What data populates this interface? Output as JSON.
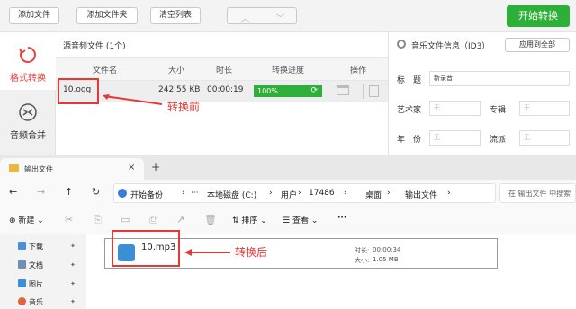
{
  "toolbar": {
    "add_file": "添加文件",
    "add_folder": "添加文件夹",
    "clear_list": "清空列表",
    "start": "开始转换"
  },
  "sidebar": {
    "items": [
      {
        "label": "格式转换"
      },
      {
        "label": "音频合并"
      }
    ]
  },
  "files": {
    "title": "源音频文件 (1个)",
    "headers": [
      "文件名",
      "大小",
      "时长",
      "转换进度",
      "操作"
    ],
    "rows": [
      {
        "name": "10.ogg",
        "size": "242.55 KB",
        "duration": "00:00:19",
        "progress": "100%",
        "progress_value": 1.0
      }
    ]
  },
  "info": {
    "title": "音乐文件信息（ID3）",
    "apply_all": "应用到全部",
    "fields": [
      {
        "label": "标　题",
        "value": "新录音",
        "placeholder": ""
      },
      {
        "label": "艺术家",
        "value": "",
        "placeholder": "无"
      },
      {
        "label": "专辑",
        "value": "",
        "placeholder": "无"
      },
      {
        "label": "年　份",
        "value": "",
        "placeholder": "无"
      },
      {
        "label": "流派",
        "value": "",
        "placeholder": "无"
      }
    ]
  },
  "annotations": {
    "before": "转换前",
    "after": "转换后",
    "color": "#e53935"
  },
  "explorer": {
    "tab": "输出文件",
    "breadcrumbs": [
      "开始备份",
      "本地磁盘 (C:)",
      "用户",
      "17486",
      "桌面",
      "输出文件"
    ],
    "search_placeholder": "在 输出文件 中搜索",
    "commands": {
      "new": "新建",
      "sort": "排序",
      "view": "查看"
    },
    "nav": [
      {
        "label": "下载",
        "icon": "download-icon",
        "color": "#4a90d9"
      },
      {
        "label": "文档",
        "icon": "document-icon",
        "color": "#6d8fb8"
      },
      {
        "label": "图片",
        "icon": "picture-icon",
        "color": "#3a8fd6"
      },
      {
        "label": "音乐",
        "icon": "music-icon",
        "color": "#e4623a"
      }
    ],
    "file": {
      "name": "10.mp3",
      "duration_label": "时长:",
      "duration": "00:00:34",
      "size_label": "大小:",
      "size": "1.05 MB"
    }
  },
  "colors": {
    "accent_green": "#2eaf3a",
    "active_red": "#e8423c"
  }
}
